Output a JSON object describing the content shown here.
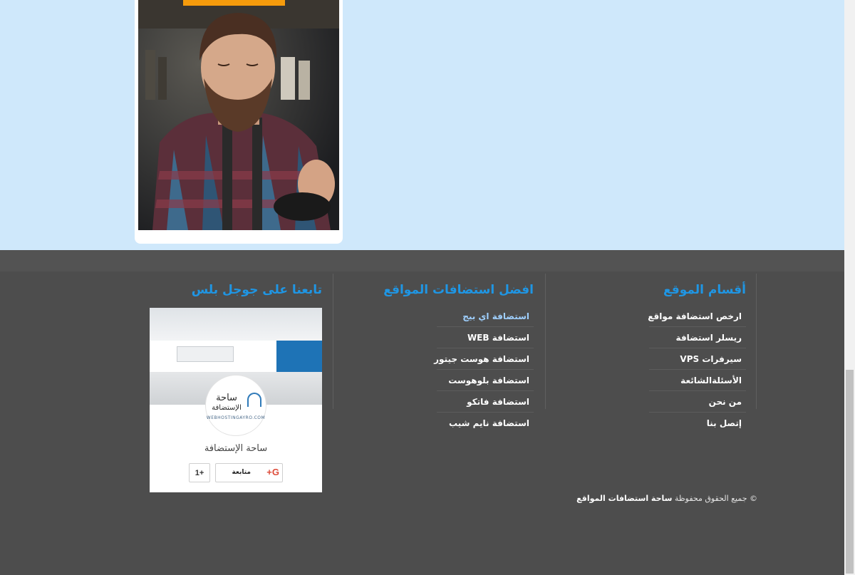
{
  "colors": {
    "hero_bg": "#cfe8fb",
    "footer_bg": "#4d4d4d",
    "accent": "#1f96e4",
    "orange": "#f59b0c"
  },
  "hero": {
    "photo_alt": "man with beard in plaid shirt"
  },
  "columns": {
    "sections": {
      "title": "أقسام الموقع",
      "items": [
        "ارخص استضافة مواقع",
        "ريسلر استضافة",
        "سيرفرات VPS",
        "الأسئلةالشائعة",
        "من نحن",
        "إتصل بنا"
      ]
    },
    "best_hosting": {
      "title": "افضل استضافات المواقع",
      "items": [
        "استضافة اي بيج",
        "استضافة WEB",
        "استضافة هوست جيتور",
        "استضافة بلوهوست",
        "استضافة فاتكو",
        "استضافة نايم شيب"
      ]
    },
    "google_plus": {
      "title": "تابعنا على جوجل بلس",
      "badge": {
        "avatar_line1": "ساحة",
        "avatar_line2": "الإستضافة",
        "avatar_url": "WEBHOSTINGAYRO.COM",
        "page_name": "ساحة الإستضافة",
        "follow_icon": "G+",
        "follow_label": "متابعة",
        "plus_one_label": "+1"
      }
    }
  },
  "footer": {
    "copyright_prefix": "© جميع الحقوق محفوظة",
    "copyright_site": "ساحة استضافات المواقع"
  }
}
